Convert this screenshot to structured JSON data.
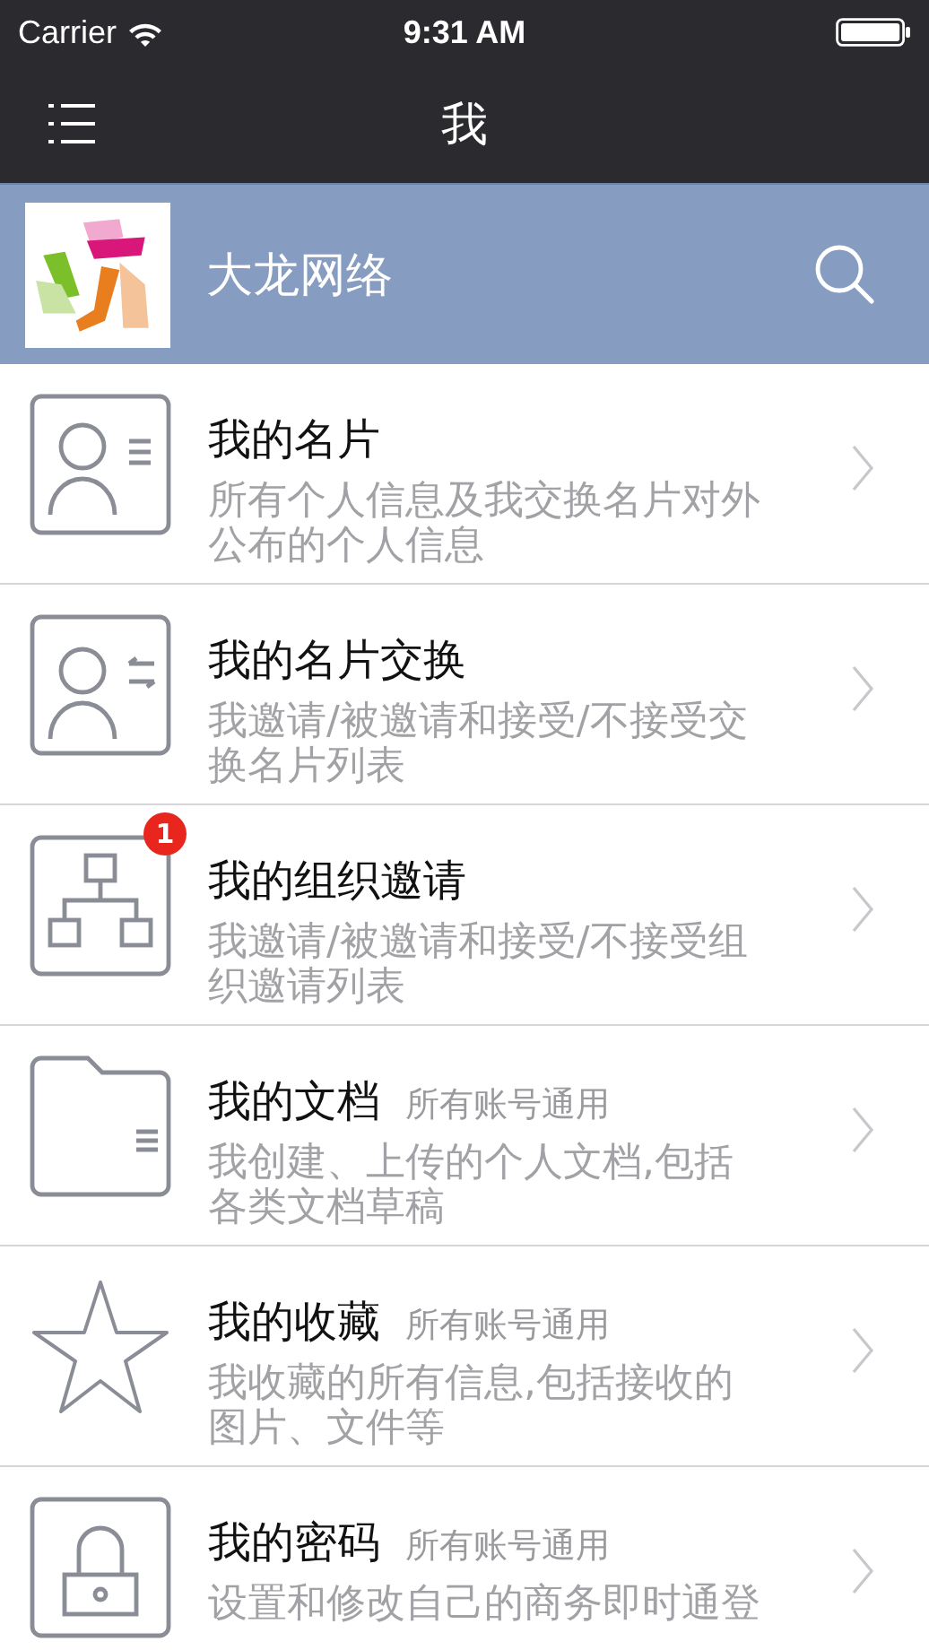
{
  "status_bar": {
    "carrier": "Carrier",
    "time": "9:31 AM"
  },
  "nav": {
    "title": "我"
  },
  "header": {
    "company": "大龙网络"
  },
  "items": [
    {
      "kind": "card",
      "title": "我的名片",
      "description": "所有个人信息及我交换名片对外公布的个人信息"
    },
    {
      "kind": "exchange",
      "title": "我的名片交换",
      "description": "我邀请/被邀请和接受/不接受交换名片列表"
    },
    {
      "kind": "org",
      "title": "我的组织邀请",
      "description": "我邀请/被邀请和接受/不接受组织邀请列表",
      "badge": "1"
    },
    {
      "kind": "folder",
      "title": "我的文档",
      "tag": "所有账号通用",
      "description": "我创建、上传的个人文档,包括各类文档草稿"
    },
    {
      "kind": "star",
      "title": "我的收藏",
      "tag": "所有账号通用",
      "description": "我收藏的所有信息,包括接收的图片、文件等"
    },
    {
      "kind": "lock",
      "title": "我的密码",
      "tag": "所有账号通用",
      "description": "设置和修改自己的商务即时通登"
    }
  ]
}
